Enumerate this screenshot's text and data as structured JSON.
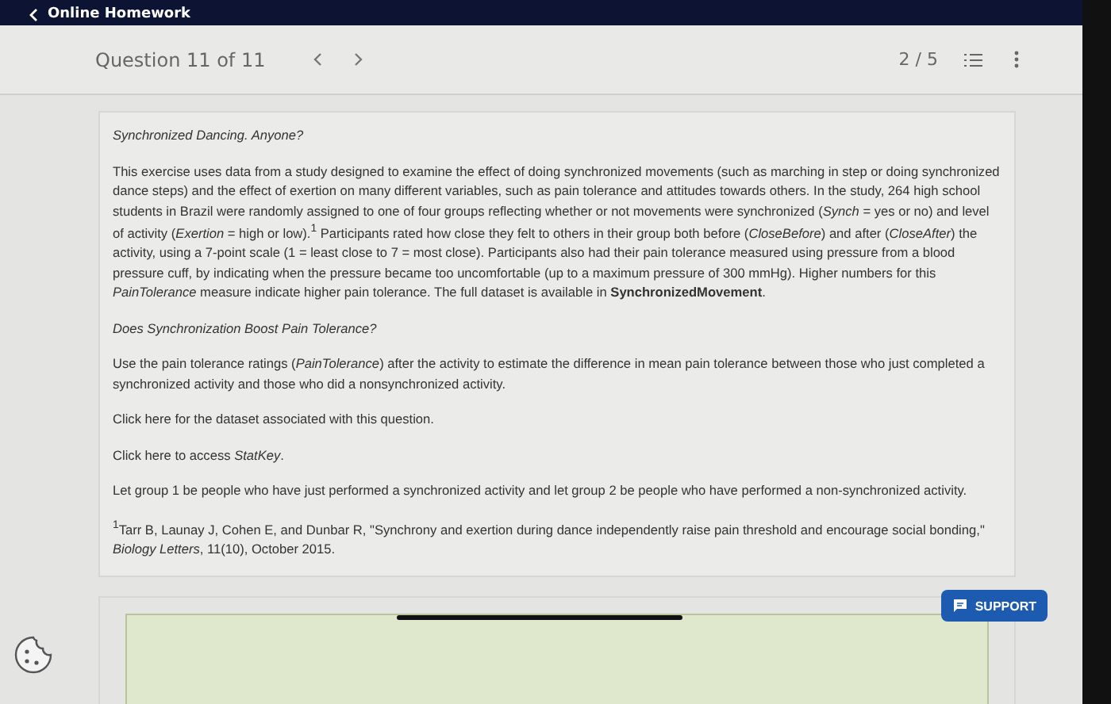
{
  "top_bar": {
    "title": "Online Homework"
  },
  "header": {
    "question": "Question 11 of 11",
    "progress": "2 / 5"
  },
  "content": {
    "title": "Synchronized Dancing. Anyone?",
    "intro": "This exercise uses data from a study designed to examine the effect of doing synchronized movements (such as marching in step or doing synchronized dance steps) and the effect of exertion on many different variables, such as pain tolerance and attitudes towards others. In the study, 264 high school students in Brazil were randomly assigned to one of four groups reflecting whether or not movements were synchronized (*Synch* =  yes or no) and level of activity (*Exertion* =  high or low).$^{1}$ Participants rated how close they felt to others in their group both before (*CloseBefore*) and after (*CloseAfter*) the activity, using a 7-point scale (1  =  least close to 7  =  most close). Participants also had their pain tolerance measured using pressure from a blood pressure cuff, by indicating when the pressure became too uncomfortable (up to a maximum pressure of 300 mmHg). Higher numbers for this *PainTolerance* measure indicate higher pain tolerance. The full dataset is available in **SynchronizedMovement**.",
    "question_title": "Does Synchronization Boost Pain Tolerance?",
    "task": "Use the pain tolerance ratings (*PainTolerance*) after the activity to estimate the difference in mean pain tolerance between those who just completed a synchronized activity and those who did a nonsynchronized activity.",
    "links": [
      {
        "link": "Click here",
        "text": " for the dataset associated with this question."
      },
      {
        "link": "Click here",
        "text": " to access *StatKey*."
      }
    ],
    "groups": "Let group 1 be people who have just performed a synchronized activity and let group 2 be people who have performed a non-synchronized activity.",
    "footnote": "$^{1}$Tarr B, Launay J, Cohen E, and Dunbar R, \"Synchrony and exertion during dance independently raise pain threshold and encourage social bonding,\" *Biology Letters*, 11(10), October 2015."
  },
  "support_button": "SUPPORT"
}
